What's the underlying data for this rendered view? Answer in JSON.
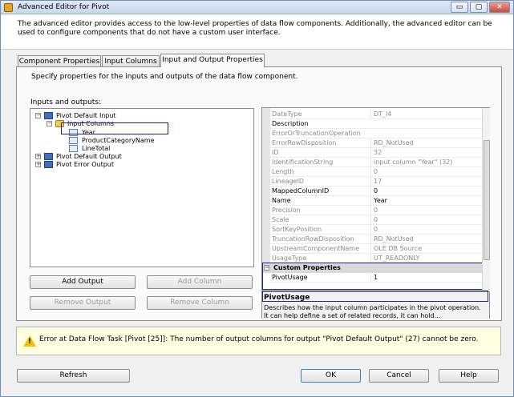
{
  "window": {
    "title": "Advanced Editor for Pivot",
    "controls": {
      "minimize": "▭",
      "maximize": "▢",
      "close": "✕"
    }
  },
  "intro": {
    "text": "The advanced editor provides access to the low-level properties of data flow components. Additionally, the advanced editor can be used to configure components that do not have a custom user interface."
  },
  "tabs": [
    {
      "label": "Component Properties",
      "active": false
    },
    {
      "label": "Input Columns",
      "active": false
    },
    {
      "label": "Input and Output Properties",
      "active": true
    }
  ],
  "panel": {
    "description": "Specify properties for the inputs and outputs of the data flow component.",
    "io_label": "Inputs and outputs:"
  },
  "tree": {
    "pivot_default_input": "Pivot Default Input",
    "input_columns": "Input Columns",
    "columns": [
      "Year",
      "ProductCategoryName",
      "LineTotal"
    ],
    "pivot_default_output": "Pivot Default Output",
    "pivot_error_output": "Pivot Error Output"
  },
  "buttons": {
    "add_output": "Add Output",
    "add_column": "Add Column",
    "remove_output": "Remove Output",
    "remove_column": "Remove Column",
    "refresh": "Refresh",
    "ok": "OK",
    "cancel": "Cancel",
    "help": "Help"
  },
  "properties": [
    {
      "name": "DataType",
      "value": "DT_I4",
      "readonly": true
    },
    {
      "name": "Description",
      "value": "",
      "readonly": false
    },
    {
      "name": "ErrorOrTruncationOperation",
      "value": "",
      "readonly": true
    },
    {
      "name": "ErrorRowDisposition",
      "value": "RD_NotUsed",
      "readonly": true
    },
    {
      "name": "ID",
      "value": "32",
      "readonly": true
    },
    {
      "name": "IdentificationString",
      "value": "input column \"Year\" (32)",
      "readonly": true
    },
    {
      "name": "Length",
      "value": "0",
      "readonly": true
    },
    {
      "name": "LineageID",
      "value": "17",
      "readonly": true
    },
    {
      "name": "MappedColumnID",
      "value": "0",
      "readonly": false
    },
    {
      "name": "Name",
      "value": "Year",
      "readonly": false
    },
    {
      "name": "Precision",
      "value": "0",
      "readonly": true
    },
    {
      "name": "Scale",
      "value": "0",
      "readonly": true
    },
    {
      "name": "SortKeyPosition",
      "value": "0",
      "readonly": true
    },
    {
      "name": "TruncationRowDisposition",
      "value": "RD_NotUsed",
      "readonly": true
    },
    {
      "name": "UpstreamComponentName",
      "value": "OLE DB Source",
      "readonly": true
    },
    {
      "name": "UsageType",
      "value": "UT_READONLY",
      "readonly": true
    }
  ],
  "custom_properties": {
    "category": "Custom Properties",
    "name": "PivotUsage",
    "value": "1"
  },
  "help": {
    "title": "PivotUsage",
    "text": "Describes how the input column participates in the pivot operation. It can help define a set of related records, it can hold..."
  },
  "error": {
    "icon": "warning-icon",
    "text": "Error at Data Flow Task [Pivot [25]]: The number of output columns for output \"Pivot Default Output\" (27) cannot be zero."
  }
}
